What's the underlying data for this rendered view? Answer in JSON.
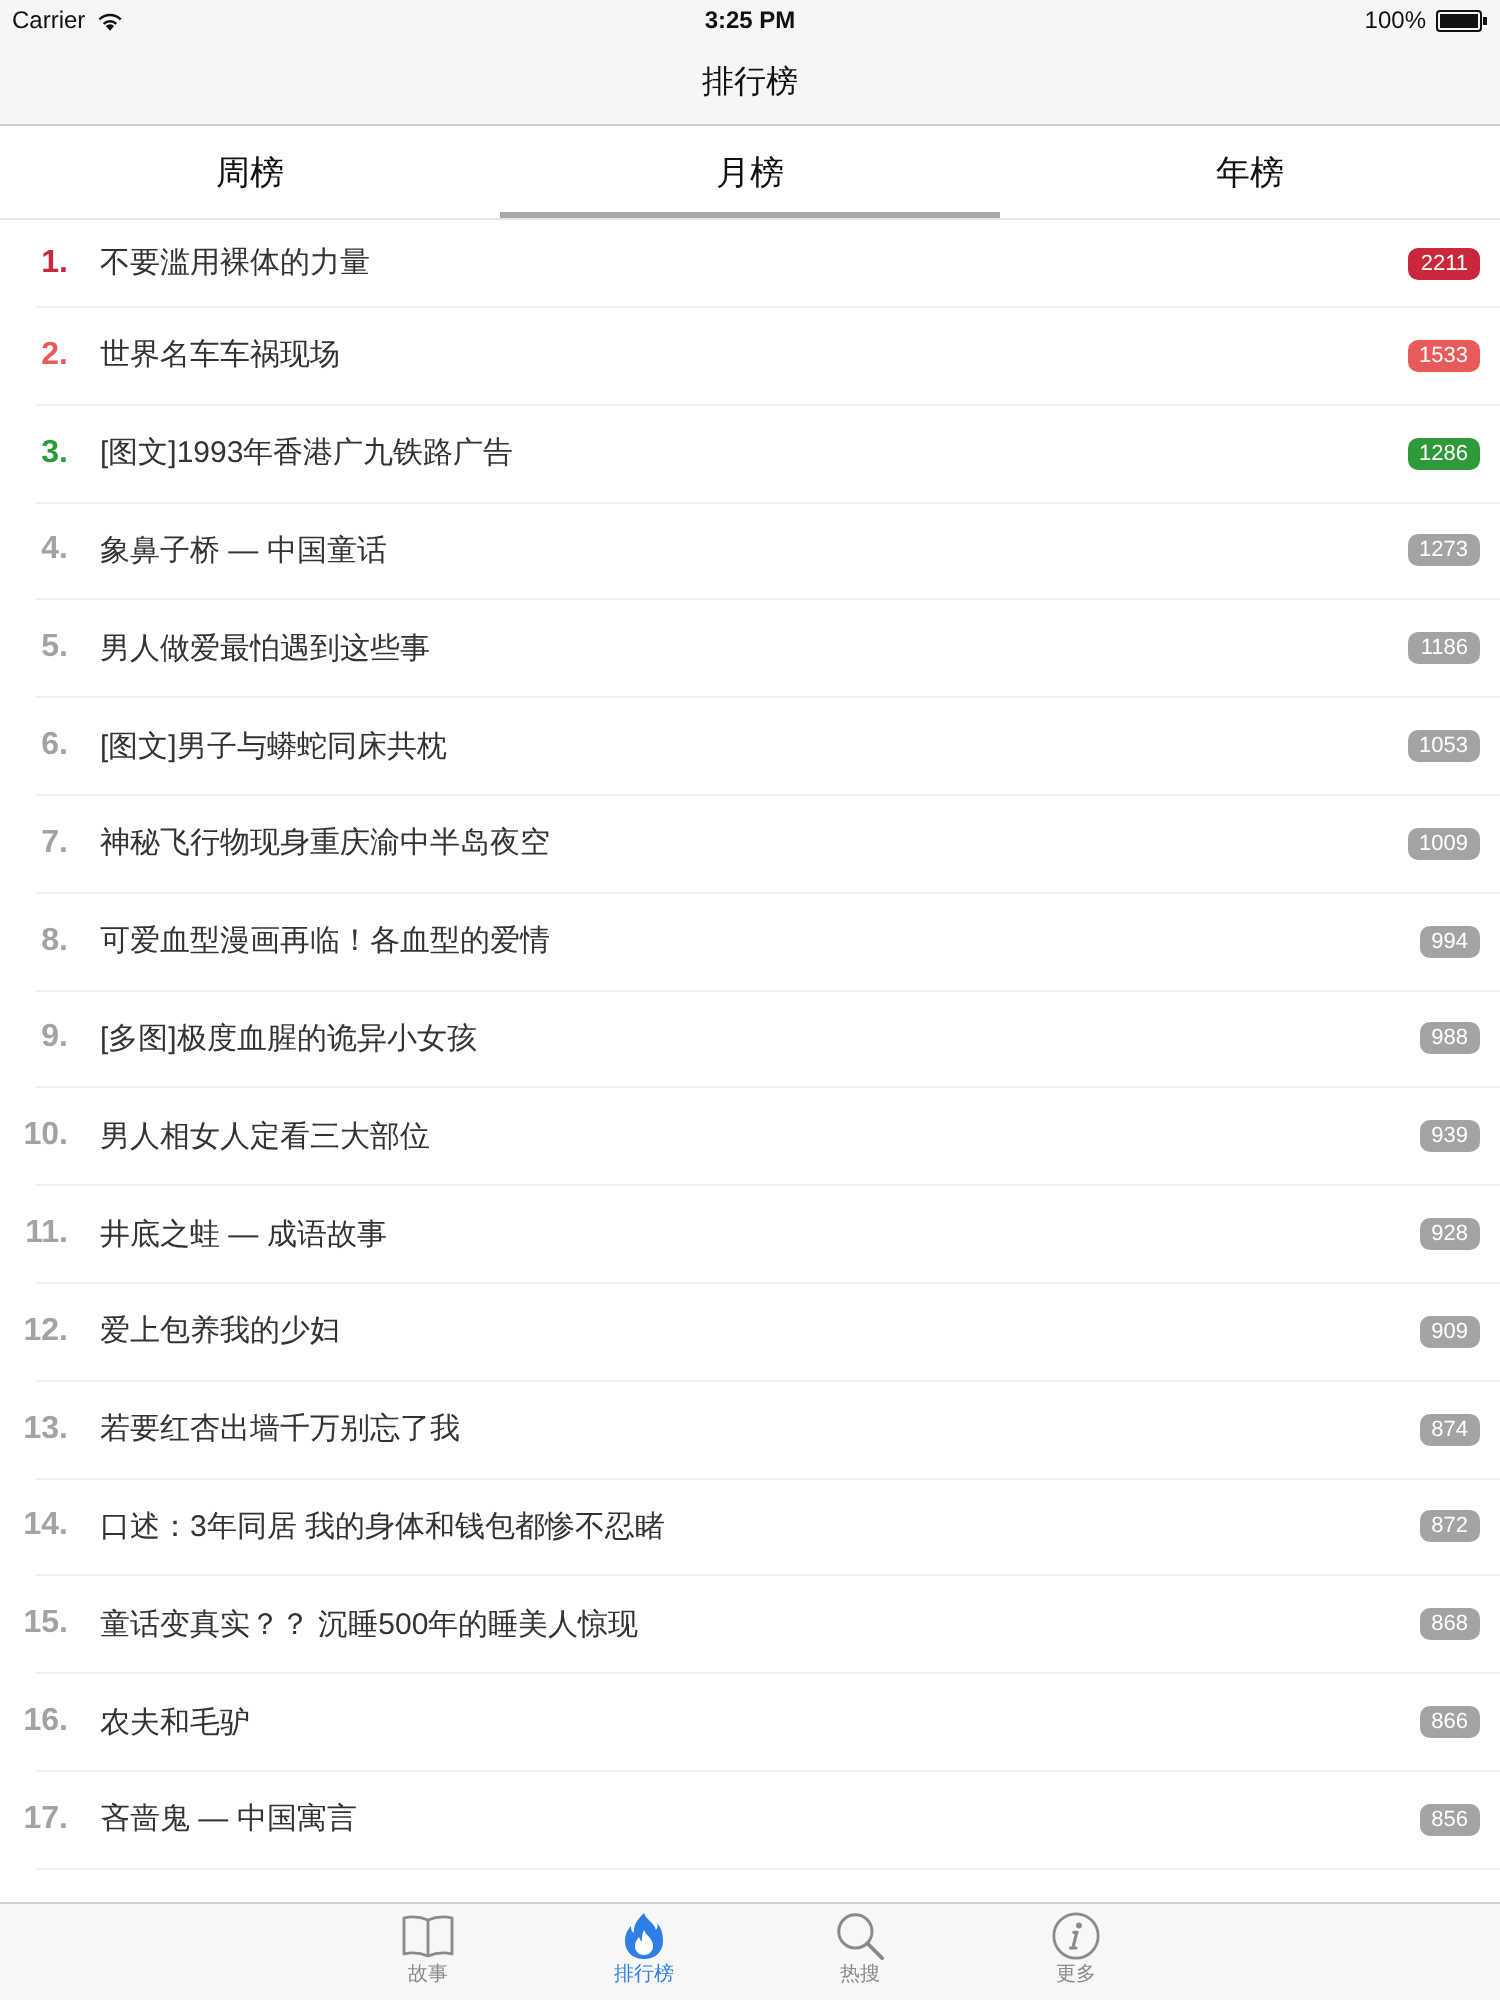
{
  "status_bar": {
    "carrier": "Carrier",
    "time": "3:25 PM",
    "battery": "100%"
  },
  "nav_bar": {
    "title": "排行榜"
  },
  "segments": [
    {
      "label": "周榜",
      "selected": false
    },
    {
      "label": "月榜",
      "selected": true
    },
    {
      "label": "年榜",
      "selected": false
    }
  ],
  "rankings": [
    {
      "rank": "1.",
      "title": "不要滥用裸体的力量",
      "count": "2211",
      "color": "#c9283a"
    },
    {
      "rank": "2.",
      "title": "世界名车车祸现场",
      "count": "1533",
      "color": "#e95a5a"
    },
    {
      "rank": "3.",
      "title": "[图文]1993年香港广九铁路广告",
      "count": "1286",
      "color": "#2e9a3a"
    },
    {
      "rank": "4.",
      "title": "象鼻子桥 — 中国童话",
      "count": "1273",
      "color": "#a3a3a3"
    },
    {
      "rank": "5.",
      "title": "男人做爱最怕遇到这些事",
      "count": "1186",
      "color": "#a3a3a3"
    },
    {
      "rank": "6.",
      "title": "[图文]男子与蟒蛇同床共枕",
      "count": "1053",
      "color": "#a3a3a3"
    },
    {
      "rank": "7.",
      "title": "神秘飞行物现身重庆渝中半岛夜空",
      "count": "1009",
      "color": "#a3a3a3"
    },
    {
      "rank": "8.",
      "title": "可爱血型漫画再临！各血型的爱情",
      "count": "994",
      "color": "#a3a3a3"
    },
    {
      "rank": "9.",
      "title": "[多图]极度血腥的诡异小女孩",
      "count": "988",
      "color": "#a3a3a3"
    },
    {
      "rank": "10.",
      "title": "男人相女人定看三大部位",
      "count": "939",
      "color": "#a3a3a3"
    },
    {
      "rank": "11.",
      "title": "井底之蛙 — 成语故事",
      "count": "928",
      "color": "#a3a3a3"
    },
    {
      "rank": "12.",
      "title": "爱上包养我的少妇",
      "count": "909",
      "color": "#a3a3a3"
    },
    {
      "rank": "13.",
      "title": "若要红杏出墙千万别忘了我",
      "count": "874",
      "color": "#a3a3a3"
    },
    {
      "rank": "14.",
      "title": "口述：3年同居 我的身体和钱包都惨不忍睹",
      "count": "872",
      "color": "#a3a3a3"
    },
    {
      "rank": "15.",
      "title": "童话变真实？？ 沉睡500年的睡美人惊现",
      "count": "868",
      "color": "#a3a3a3"
    },
    {
      "rank": "16.",
      "title": "农夫和毛驴",
      "count": "866",
      "color": "#a3a3a3"
    },
    {
      "rank": "17.",
      "title": "吝啬鬼 — 中国寓言",
      "count": "856",
      "color": "#a3a3a3"
    }
  ],
  "tab_bar": [
    {
      "label": "故事",
      "kind": "book",
      "selected": false
    },
    {
      "label": "排行榜",
      "kind": "flame",
      "selected": true
    },
    {
      "label": "热搜",
      "kind": "search",
      "selected": false
    },
    {
      "label": "更多",
      "kind": "info",
      "selected": false
    }
  ]
}
